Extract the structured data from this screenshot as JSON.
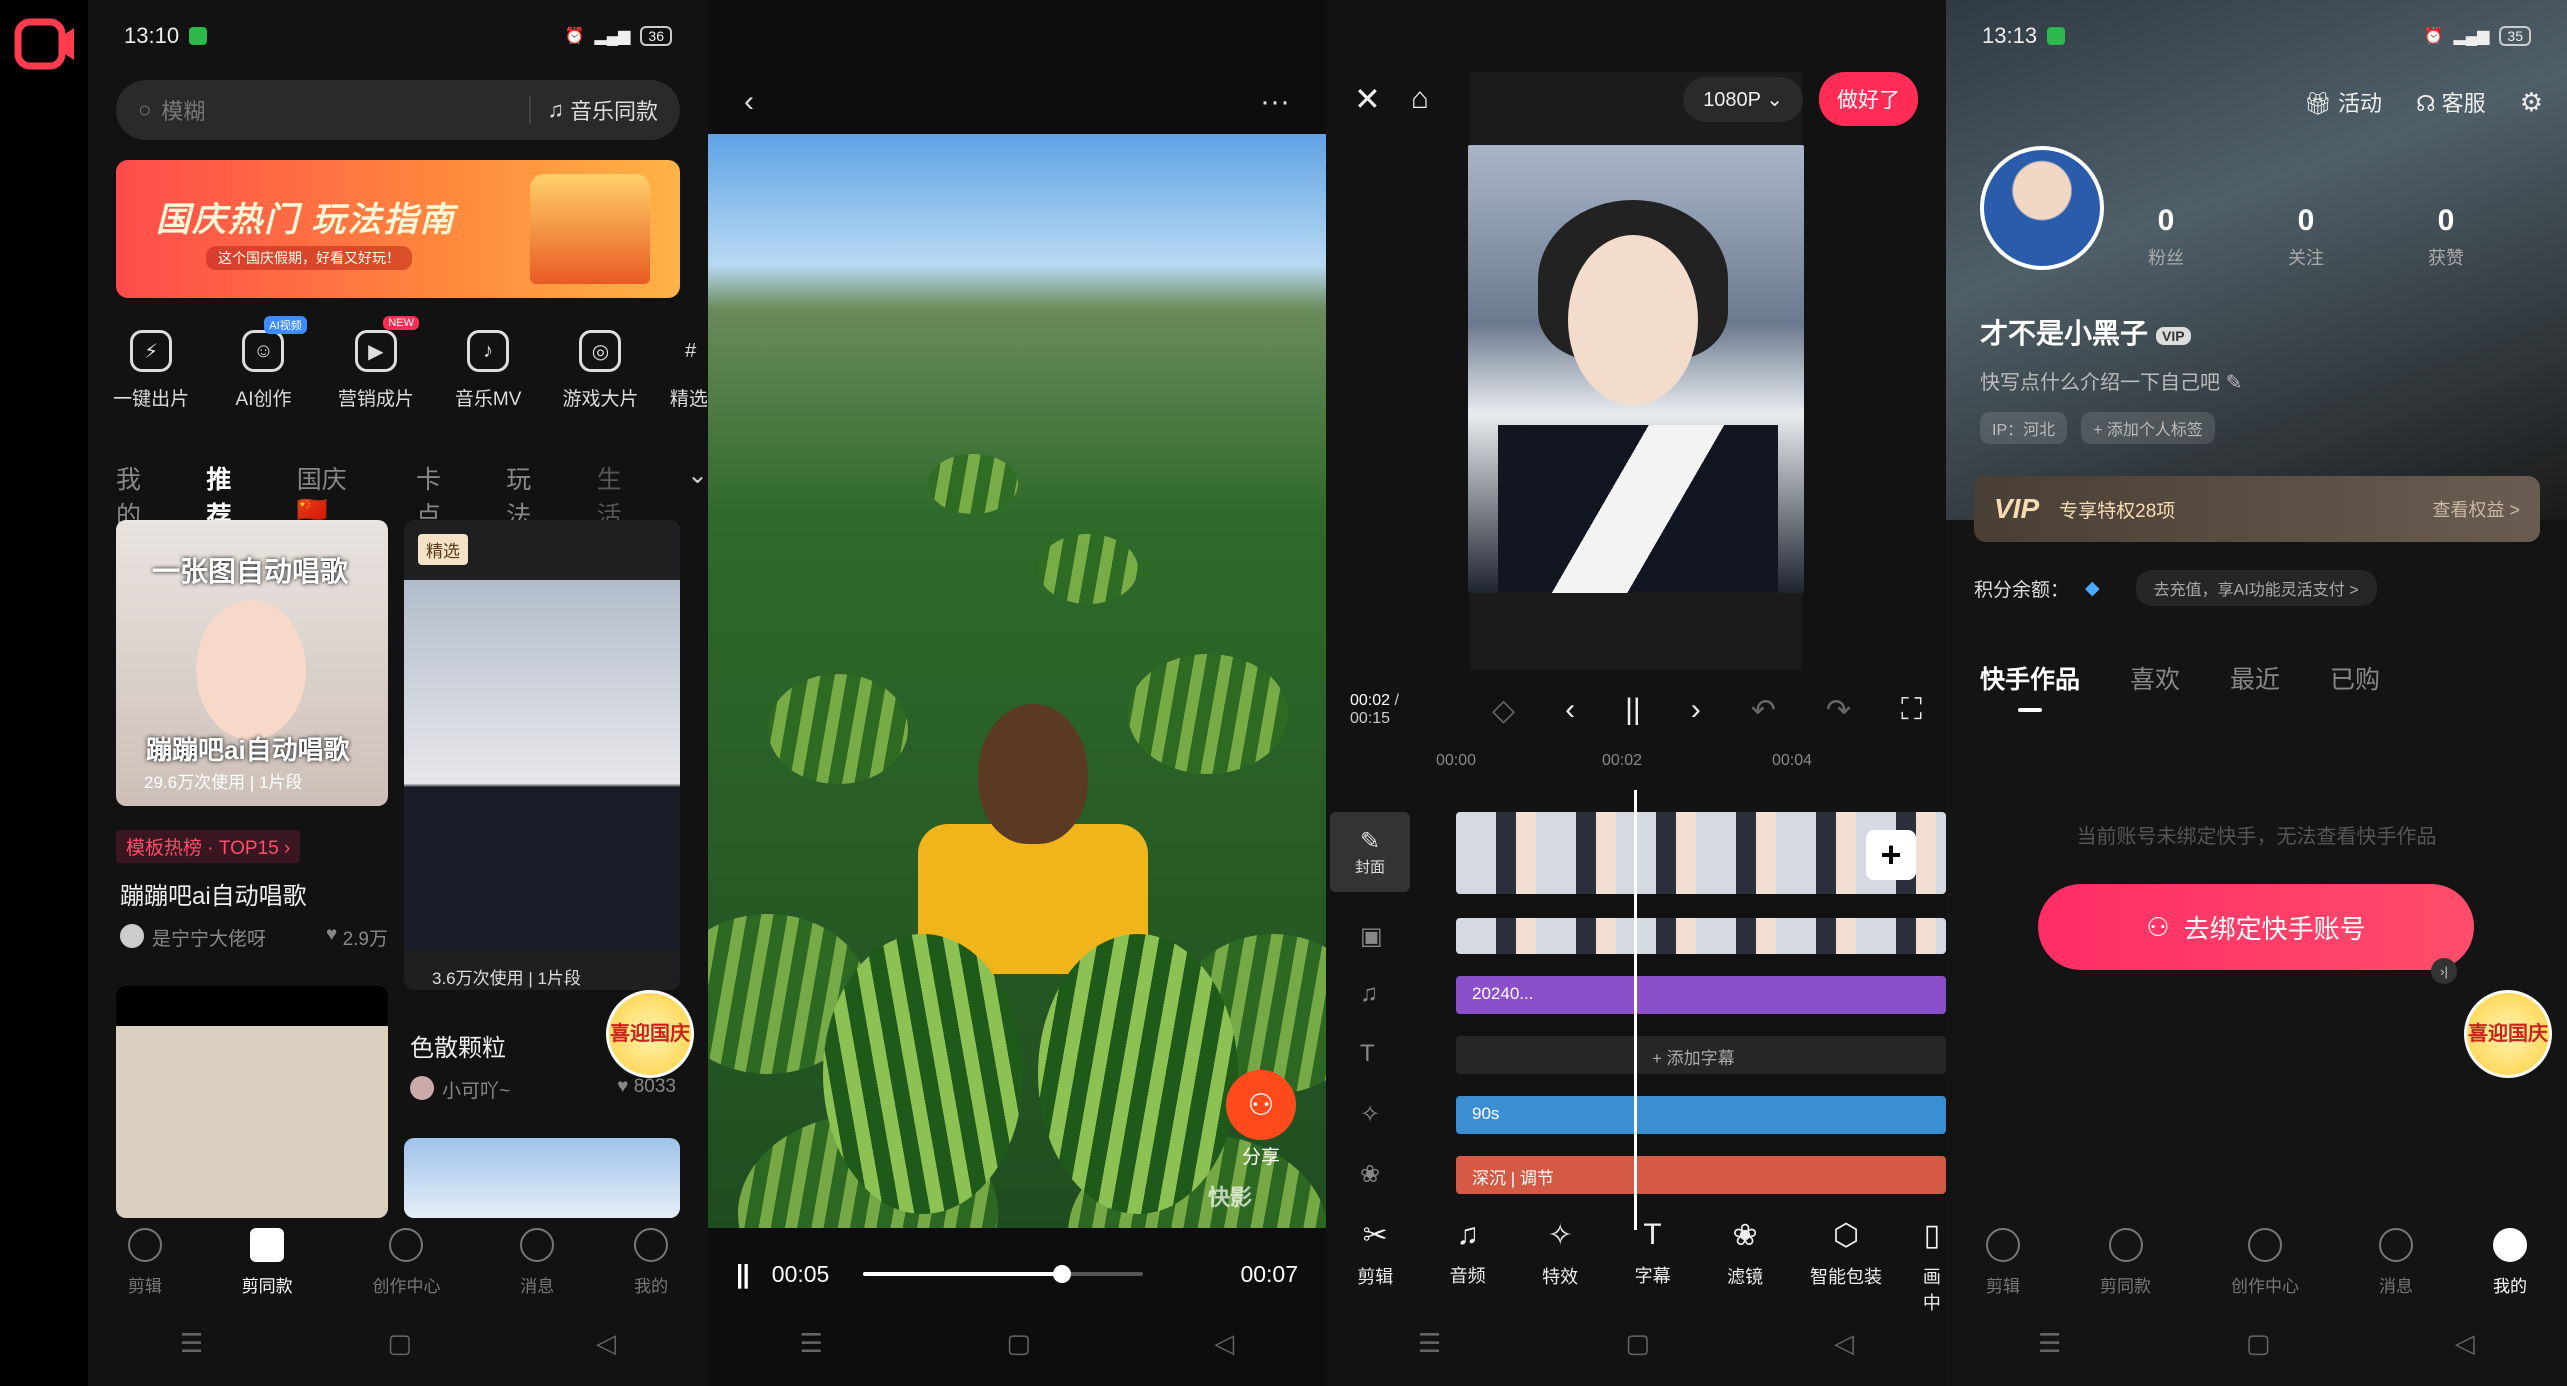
{
  "colors": {
    "accent": "#ff2d55",
    "share": "#ff4a1c",
    "audio_track": "#8a4fc9",
    "filter_track": "#3b8ed0",
    "adjust_track": "#d45a45"
  },
  "screen1": {
    "status": {
      "time": "13:10",
      "battery": "36"
    },
    "search": {
      "placeholder": "模糊",
      "music_same": "音乐同款"
    },
    "banner": {
      "title": "国庆热门 玩法指南",
      "subtitle": "这个国庆假期，好看又好玩！"
    },
    "quick": [
      {
        "label": "一键出片",
        "icon": "lightning-icon",
        "badge": ""
      },
      {
        "label": "AI创作",
        "icon": "robot-icon",
        "badge": "AI视频"
      },
      {
        "label": "营销成片",
        "icon": "video-play-icon",
        "badge": "NEW"
      },
      {
        "label": "音乐MV",
        "icon": "music-note-icon",
        "badge": ""
      },
      {
        "label": "游戏大片",
        "icon": "gamepad-icon",
        "badge": ""
      },
      {
        "label": "精选",
        "icon": "hash-icon",
        "badge": ""
      }
    ],
    "tabs": [
      "我的",
      "推荐",
      "国庆🇨🇳",
      "卡点",
      "玩法",
      "生活"
    ],
    "card1": {
      "overlay_title": "一张图自动唱歌",
      "overlay_sub": "蹦蹦吧ai自动唱歌",
      "usage": "29.6万次使用 | 1片段",
      "hot_tag": "模板热榜 · TOP15",
      "title": "蹦蹦吧ai自动唱歌",
      "author": "是宁宁大佬呀",
      "likes": "2.9万"
    },
    "card2": {
      "tag": "精选",
      "usage": "3.6万次使用 | 1片段",
      "title": "色散颗粒",
      "author": "小可吖~",
      "likes": "8033"
    },
    "festive_badge": "喜迎国庆",
    "bottom_tabs": [
      "剪辑",
      "剪同款",
      "创作中心",
      "消息",
      "我的"
    ]
  },
  "screen2": {
    "share_label": "分享",
    "watermark": "快影",
    "player": {
      "current": "00:05",
      "total": "00:07",
      "progress_fraction": 0.71
    }
  },
  "screen3": {
    "resolution": "1080P",
    "done_label": "做好了",
    "time": {
      "current": "00:02",
      "total": "00:15"
    },
    "ruler": [
      "00:00",
      "00:02",
      "00:04"
    ],
    "cover_label": "封面",
    "tracks": {
      "audio": "20240...",
      "subtitle_add": "添加字幕",
      "filter": "90s",
      "adjust": "深沉 | 调节"
    },
    "tools": [
      {
        "label": "剪辑",
        "icon": "scissors-icon"
      },
      {
        "label": "音频",
        "icon": "music-icon"
      },
      {
        "label": "特效",
        "icon": "star-icon"
      },
      {
        "label": "字幕",
        "icon": "text-icon"
      },
      {
        "label": "滤镜",
        "icon": "filter-icon"
      },
      {
        "label": "智能包装",
        "icon": "package-icon"
      },
      {
        "label": "画中",
        "icon": "pip-icon"
      }
    ]
  },
  "screen4": {
    "status": {
      "time": "13:13",
      "battery": "35"
    },
    "actions": {
      "activity": "活动",
      "service": "客服"
    },
    "stats": [
      {
        "n": "0",
        "l": "粉丝"
      },
      {
        "n": "0",
        "l": "关注"
      },
      {
        "n": "0",
        "l": "获赞"
      }
    ],
    "username": "才不是小黑子",
    "intro": "快写点什么介绍一下自己吧",
    "ip": "IP：河北",
    "add_tag": "+ 添加个人标签",
    "vip": {
      "logo": "VIP",
      "perks": "专享特权28项",
      "view": "查看权益 >"
    },
    "points": {
      "label": "积分余额：",
      "hint": "去充值，享AI功能灵活支付 >"
    },
    "tabs": [
      "快手作品",
      "喜欢",
      "最近",
      "已购"
    ],
    "empty": "当前账号未绑定快手，无法查看快手作品",
    "bind_button": "去绑定快手账号",
    "festive_badge": "喜迎国庆",
    "bottom_tabs": [
      "剪辑",
      "剪同款",
      "创作中心",
      "消息",
      "我的"
    ]
  }
}
